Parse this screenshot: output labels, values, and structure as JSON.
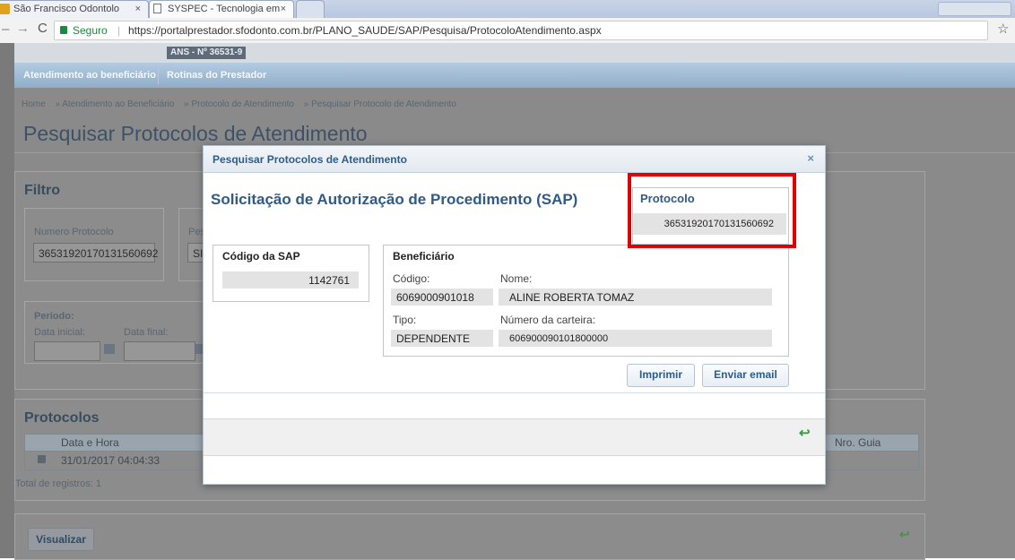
{
  "browser": {
    "tabs": [
      {
        "title": "São Francisco Odontolo",
        "close": "×"
      },
      {
        "title": "SYSPEC - Tecnologia em",
        "close": "×"
      }
    ],
    "secure_label": "Seguro",
    "url": "https://portalprestador.sfodonto.com.br/PLANO_SAUDE/SAP/Pesquisa/ProtocoloAtendimento.aspx"
  },
  "header": {
    "ans": "ANS - Nº 36531-9"
  },
  "nav": {
    "items": [
      "Atendimento ao beneficiário",
      "Rotinas do Prestador"
    ]
  },
  "breadcrumb": [
    "Home",
    "» Atendimento ao Beneficiário",
    "» Protocolo de Atendimento",
    "» Pesquisar Protocolo de Atendimento"
  ],
  "page": {
    "title": "Pesquisar Protocolos de Atendimento"
  },
  "filtro": {
    "title": "Filtro",
    "numero_label": "Numero Protocolo",
    "numero_value": "36531920170131560692",
    "pes_label": "Pes",
    "sel_value": "SI",
    "periodo_label": "Período:",
    "data_inicial_label": "Data inicial:",
    "data_final_label": "Data final:"
  },
  "protocolos": {
    "title": "Protocolos",
    "col_data": "Data e Hora",
    "col_guia": "Nro. Guia",
    "row_date": "31/01/2017 04:04:33",
    "total": "Total de registros: 1",
    "visualizar": "Visualizar"
  },
  "modal": {
    "title": "Pesquisar Protocolos de Atendimento",
    "close": "×",
    "heading": "Solicitação de Autorização de Procedimento (SAP)",
    "protocolo_label": "Protocolo",
    "protocolo_value": "36531920170131560692",
    "sap_label": "Código da SAP",
    "sap_value": "1142761",
    "benef_label": "Beneficiário",
    "codigo_label": "Código:",
    "codigo_value": "6069000901018",
    "nome_label": "Nome:",
    "nome_value": "ALINE ROBERTA TOMAZ",
    "tipo_label": "Tipo:",
    "tipo_value": "DEPENDENTE",
    "carteira_label": "Número da carteira:",
    "carteira_value": "606900090101800000",
    "btn_imprimir": "Imprimir",
    "btn_email": "Enviar email"
  },
  "colors": {
    "highlight": "#e00000",
    "accent": "#2f5b86"
  }
}
